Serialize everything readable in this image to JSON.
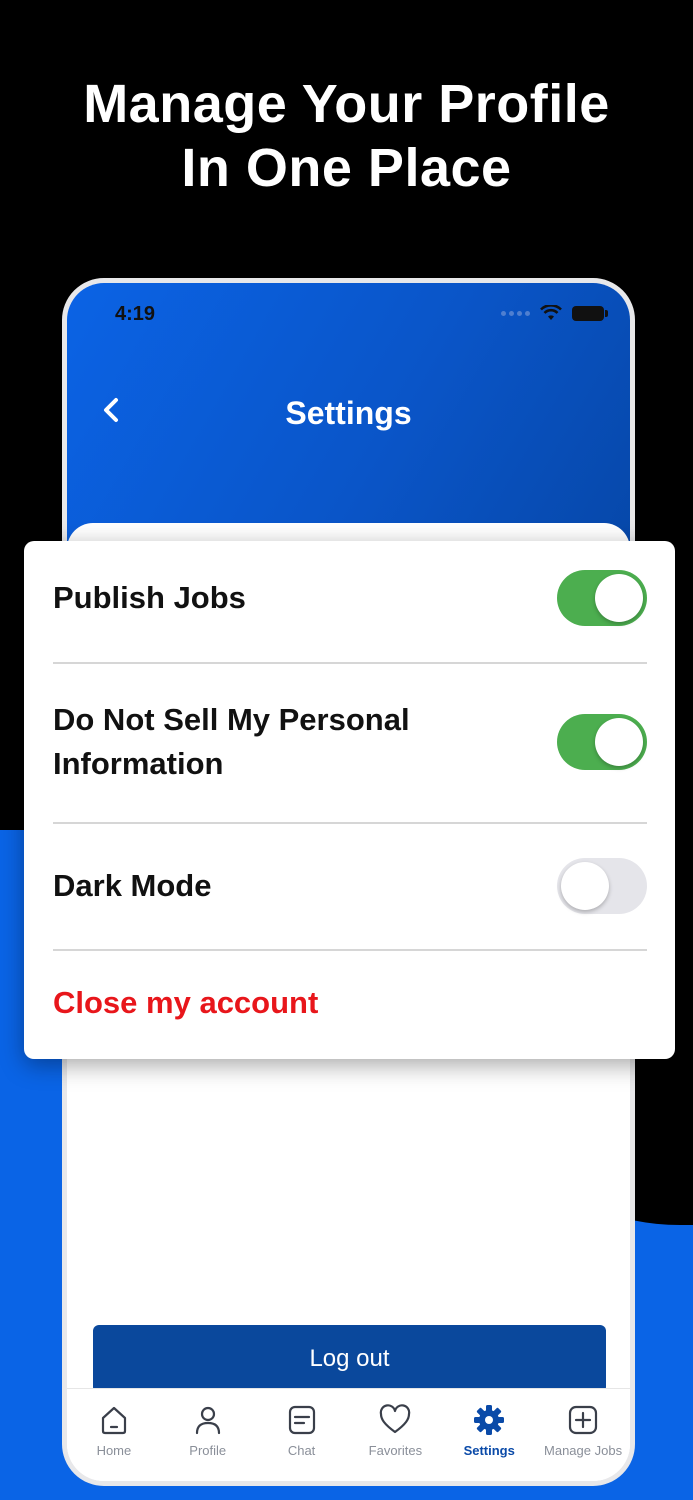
{
  "hero": {
    "line1": "Manage Your Profile",
    "line2": "In One Place"
  },
  "status_bar": {
    "time": "4:19"
  },
  "header": {
    "title": "Settings",
    "back_icon": "chevron-left-icon"
  },
  "settings": {
    "rows": [
      {
        "label": "Publish Jobs",
        "enabled": true
      },
      {
        "label": "Do Not Sell My Personal Information",
        "enabled": true
      },
      {
        "label": "Dark Mode",
        "enabled": false
      }
    ],
    "close_account": "Close my account"
  },
  "logout_label": "Log out",
  "tabs": [
    {
      "label": "Home",
      "icon": "home-icon"
    },
    {
      "label": "Profile",
      "icon": "user-icon"
    },
    {
      "label": "Chat",
      "icon": "chat-icon"
    },
    {
      "label": "Favorites",
      "icon": "heart-icon"
    },
    {
      "label": "Settings",
      "icon": "gear-icon",
      "active": true
    },
    {
      "label": "Manage Jobs",
      "icon": "plus-square-icon"
    }
  ],
  "colors": {
    "brand_blue": "#0a64e6",
    "dark_blue": "#0a489c",
    "toggle_on": "#4cae4f",
    "danger": "#e8161b"
  }
}
